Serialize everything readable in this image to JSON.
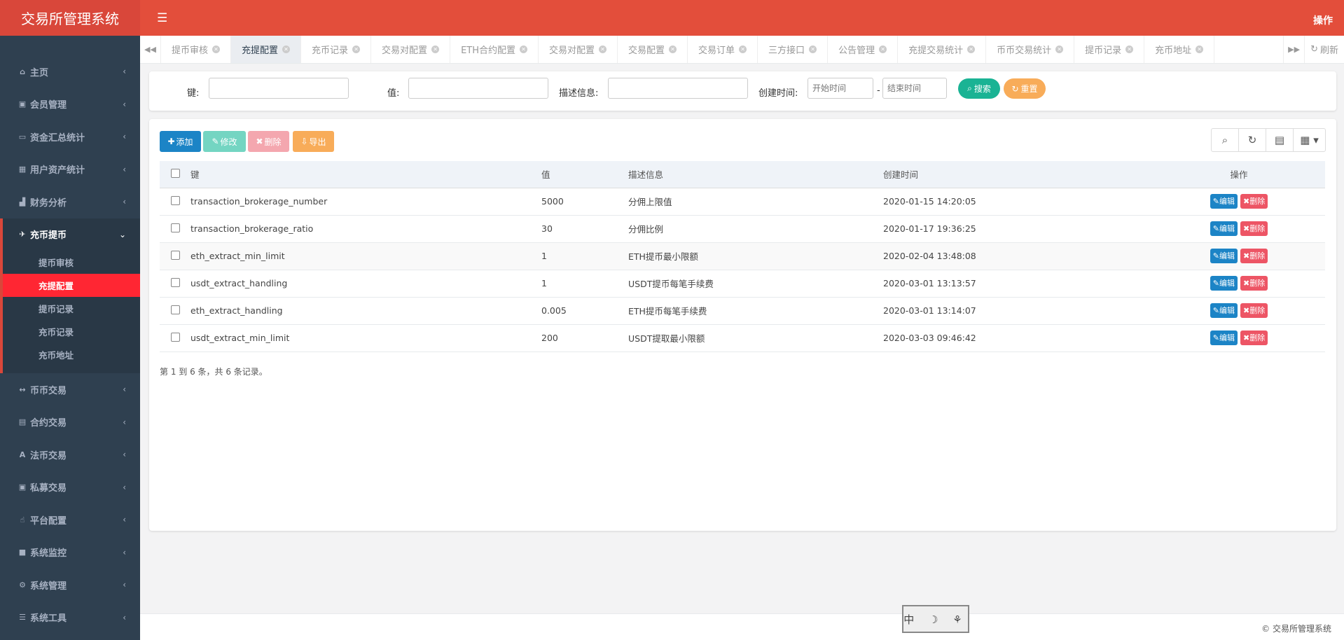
{
  "app": {
    "title": "交易所管理系统",
    "topbar_right": "操作",
    "footer": "© 交易所管理系统"
  },
  "sidebar": {
    "items": [
      {
        "label": "主页",
        "icon": "home-icon"
      },
      {
        "label": "会员管理",
        "icon": "member-icon"
      },
      {
        "label": "资金汇总统计",
        "icon": "money-icon"
      },
      {
        "label": "用户资产统计",
        "icon": "building-icon"
      },
      {
        "label": "财务分析",
        "icon": "chart-icon"
      }
    ],
    "open_group": {
      "label": "充币提币",
      "icon": "plane-icon",
      "children": [
        "提币审核",
        "充提配置",
        "提币记录",
        "充币记录",
        "充币地址"
      ],
      "active_child": "充提配置"
    },
    "items_after": [
      {
        "label": "币币交易",
        "icon": "arrows-icon"
      },
      {
        "label": "合约交易",
        "icon": "book-icon"
      },
      {
        "label": "法币交易",
        "icon": "language-icon"
      },
      {
        "label": "私募交易",
        "icon": "contact-icon"
      },
      {
        "label": "平台配置",
        "icon": "hand-icon"
      },
      {
        "label": "系统监控",
        "icon": "camera-icon"
      },
      {
        "label": "系统管理",
        "icon": "gear-icon"
      },
      {
        "label": "系统工具",
        "icon": "bars-icon"
      }
    ]
  },
  "tabs": {
    "items": [
      "提币审核",
      "充提配置",
      "充币记录",
      "交易对配置",
      "ETH合约配置",
      "交易对配置",
      "交易配置",
      "交易订单",
      "三方接口",
      "公告管理",
      "充提交易统计",
      "币币交易统计",
      "提币记录",
      "充币地址"
    ],
    "active": "充提配置",
    "refresh_label": "刷新"
  },
  "search": {
    "key_label": "键:",
    "value_label": "值:",
    "desc_label": "描述信息:",
    "created_label": "创建时间:",
    "start_placeholder": "开始时间",
    "end_placeholder": "结束时间",
    "range_sep": "-",
    "search_button": "搜索",
    "reset_button": "重置"
  },
  "toolbar": {
    "add": "添加",
    "edit": "修改",
    "delete": "删除",
    "export": "导出"
  },
  "colors": {
    "primary": "#1c84c6",
    "teal": "#1ab394",
    "orange": "#f8ac59",
    "red": "#ed5565",
    "brand_red": "#e34e3b"
  },
  "table": {
    "columns": [
      "键",
      "值",
      "描述信息",
      "创建时间",
      "操作"
    ],
    "edit_label": "编辑",
    "delete_label": "删除",
    "rows": [
      {
        "key": "transaction_brokerage_number",
        "value": "5000",
        "desc": "分佣上限值",
        "created": "2020-01-15 14:20:05"
      },
      {
        "key": "transaction_brokerage_ratio",
        "value": "30",
        "desc": "分佣比例",
        "created": "2020-01-17 19:36:25"
      },
      {
        "key": "eth_extract_min_limit",
        "value": "1",
        "desc": "ETH提币最小限额",
        "created": "2020-02-04 13:48:08"
      },
      {
        "key": "usdt_extract_handling",
        "value": "1",
        "desc": "USDT提币每笔手续费",
        "created": "2020-03-01 13:13:57"
      },
      {
        "key": "eth_extract_handling",
        "value": "0.005",
        "desc": "ETH提币每笔手续费",
        "created": "2020-03-01 13:14:07"
      },
      {
        "key": "usdt_extract_min_limit",
        "value": "200",
        "desc": "USDT提取最小限额",
        "created": "2020-03-03 09:46:42"
      }
    ],
    "pagination": "第 1 到 6 条，共 6 条记录。"
  }
}
